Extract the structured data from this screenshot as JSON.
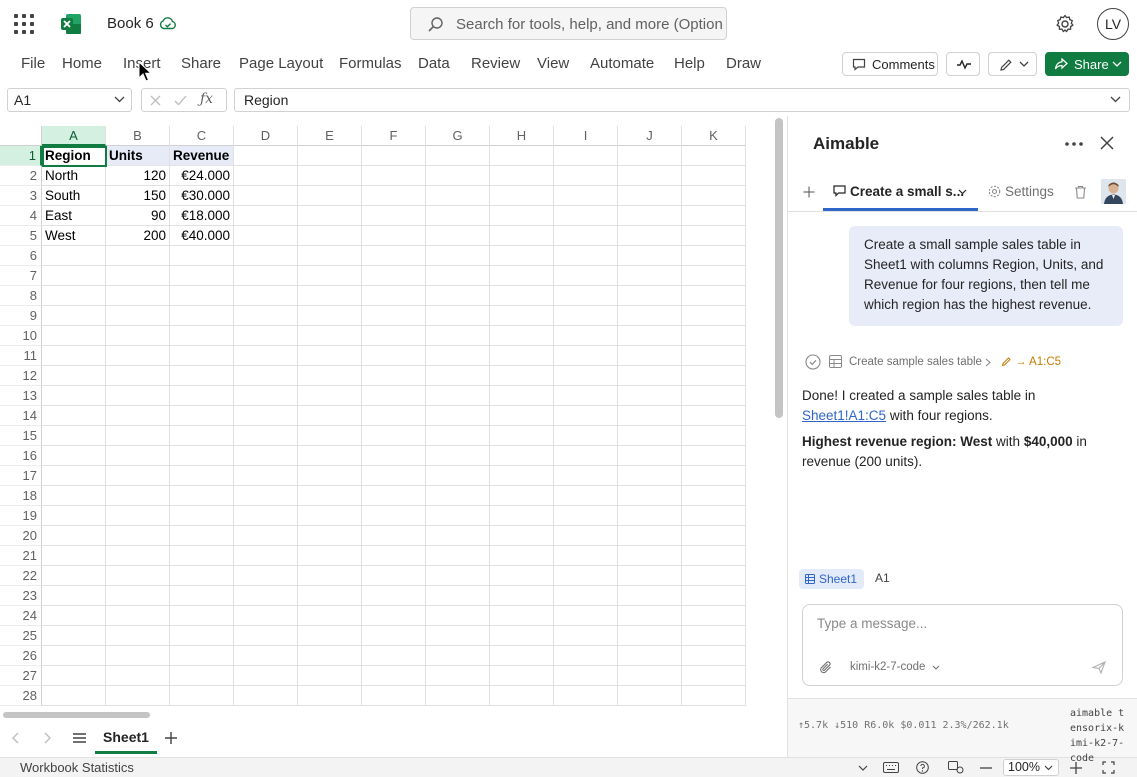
{
  "app": {
    "workbook_name": "Book 6",
    "search_placeholder": "Search for tools, help, and more (Option + Q)",
    "user_initials": "LV"
  },
  "ribbon": {
    "tabs": [
      "File",
      "Home",
      "Insert",
      "Share",
      "Page Layout",
      "Formulas",
      "Data",
      "Review",
      "View",
      "Automate",
      "Help",
      "Draw"
    ],
    "comments_label": "Comments",
    "share_label": "Share"
  },
  "formula_bar": {
    "name_box": "A1",
    "formula": "Region"
  },
  "grid": {
    "columns": [
      "A",
      "B",
      "C",
      "D",
      "E",
      "F",
      "G",
      "H",
      "I",
      "J",
      "K"
    ],
    "rows": [
      "1",
      "2",
      "3",
      "4",
      "5",
      "6",
      "7",
      "8",
      "9",
      "10",
      "11",
      "12",
      "13",
      "14",
      "15",
      "16",
      "17",
      "18",
      "19",
      "20",
      "21",
      "22",
      "23",
      "24",
      "25",
      "26",
      "27",
      "28"
    ],
    "cells": [
      [
        "Region",
        "Units",
        "Revenue"
      ],
      [
        "North",
        "120",
        "€24.000"
      ],
      [
        "South",
        "150",
        "€30.000"
      ],
      [
        "East",
        "90",
        "€18.000"
      ],
      [
        "West",
        "200",
        "€40.000"
      ]
    ]
  },
  "sheets": {
    "active": "Sheet1"
  },
  "status_bar": {
    "workbook_statistics": "Workbook Statistics",
    "zoom": "100%"
  },
  "pane": {
    "title": "Aimable",
    "conversation_tab": "Create a small s...",
    "settings_label": "Settings",
    "user_message": "Create a small sample sales table in Sheet1 with columns Region, Units, and Revenue for four regions, then tell me which region has the highest revenue.",
    "tool_step": {
      "label": "Create sample sales table",
      "range": "→ A1:C5"
    },
    "assistant": {
      "line1_prefix": "Done! I created a sample sales table in ",
      "line1_link": "Sheet1!A1:C5",
      "line1_suffix": " with four regions.",
      "line2_bold": "Highest revenue region: West",
      "line2_mid": " with ",
      "line2_bold2": "$40,000",
      "line2_suffix": " in revenue (200 units)."
    },
    "context_sheet": "Sheet1",
    "context_cell": "A1",
    "composer_placeholder": "Type a message...",
    "model": "kimi-k2-7-code",
    "footer_stats": "↑5.7k ↓510 R6.0k $0.011 2.3%/262.1k",
    "footer_provider": "aimable tensorix-kimi-k2-7-code"
  },
  "colors": {
    "excel_green": "#107c41",
    "accent_blue": "#2f66c8",
    "selection_fill": "#e6ebf7"
  }
}
